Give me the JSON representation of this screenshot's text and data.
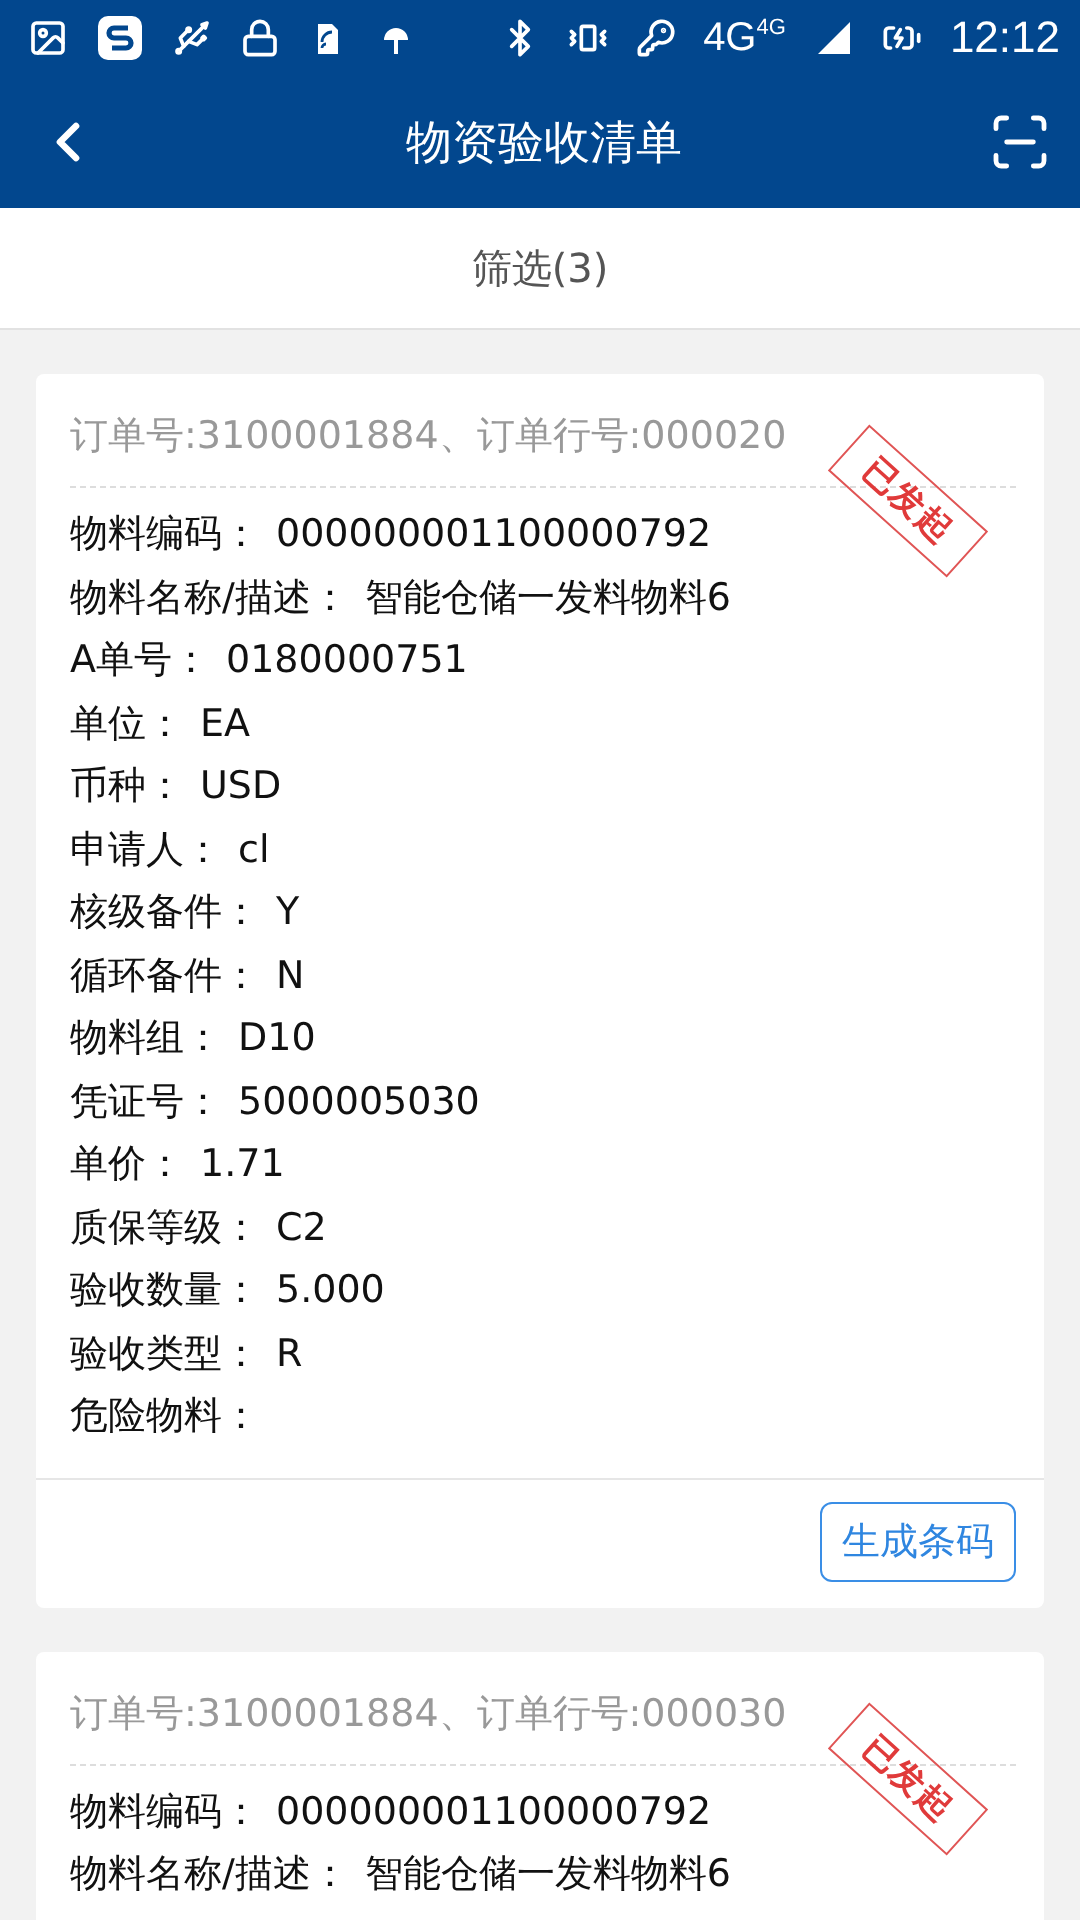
{
  "status_bar": {
    "network": "4G",
    "network_small": "4G",
    "time": "12:12"
  },
  "header": {
    "title": "物资验收清单"
  },
  "filter": {
    "label": "筛选(3)"
  },
  "cards": [
    {
      "order": "订单号:3100001884、订单行号:000020",
      "stamp": "已发起",
      "fields": [
        {
          "label": "物料编码：",
          "value": "000000001100000792"
        },
        {
          "label": "物料名称/描述：",
          "value": "智能仓储一发料物料6"
        },
        {
          "label": "A单号：",
          "value": "0180000751"
        },
        {
          "label": "单位：",
          "value": "EA"
        },
        {
          "label": "币种：",
          "value": "USD"
        },
        {
          "label": "申请人：",
          "value": "cl"
        },
        {
          "label": "核级备件：",
          "value": "Y"
        },
        {
          "label": "循环备件：",
          "value": "N"
        },
        {
          "label": "物料组：",
          "value": "D10"
        },
        {
          "label": "凭证号：",
          "value": "5000005030"
        },
        {
          "label": "单价：",
          "value": "1.71"
        },
        {
          "label": "质保等级：",
          "value": "C2"
        },
        {
          "label": "验收数量：",
          "value": "5.000"
        },
        {
          "label": "验收类型：",
          "value": "R"
        },
        {
          "label": "危险物料："
        }
      ],
      "button": "生成条码"
    },
    {
      "order": "订单号:3100001884、订单行号:000030",
      "stamp": "已发起",
      "fields": [
        {
          "label": "物料编码：",
          "value": "000000001100000792"
        },
        {
          "label": "物料名称/描述：",
          "value": "智能仓储一发料物料6"
        }
      ]
    }
  ]
}
